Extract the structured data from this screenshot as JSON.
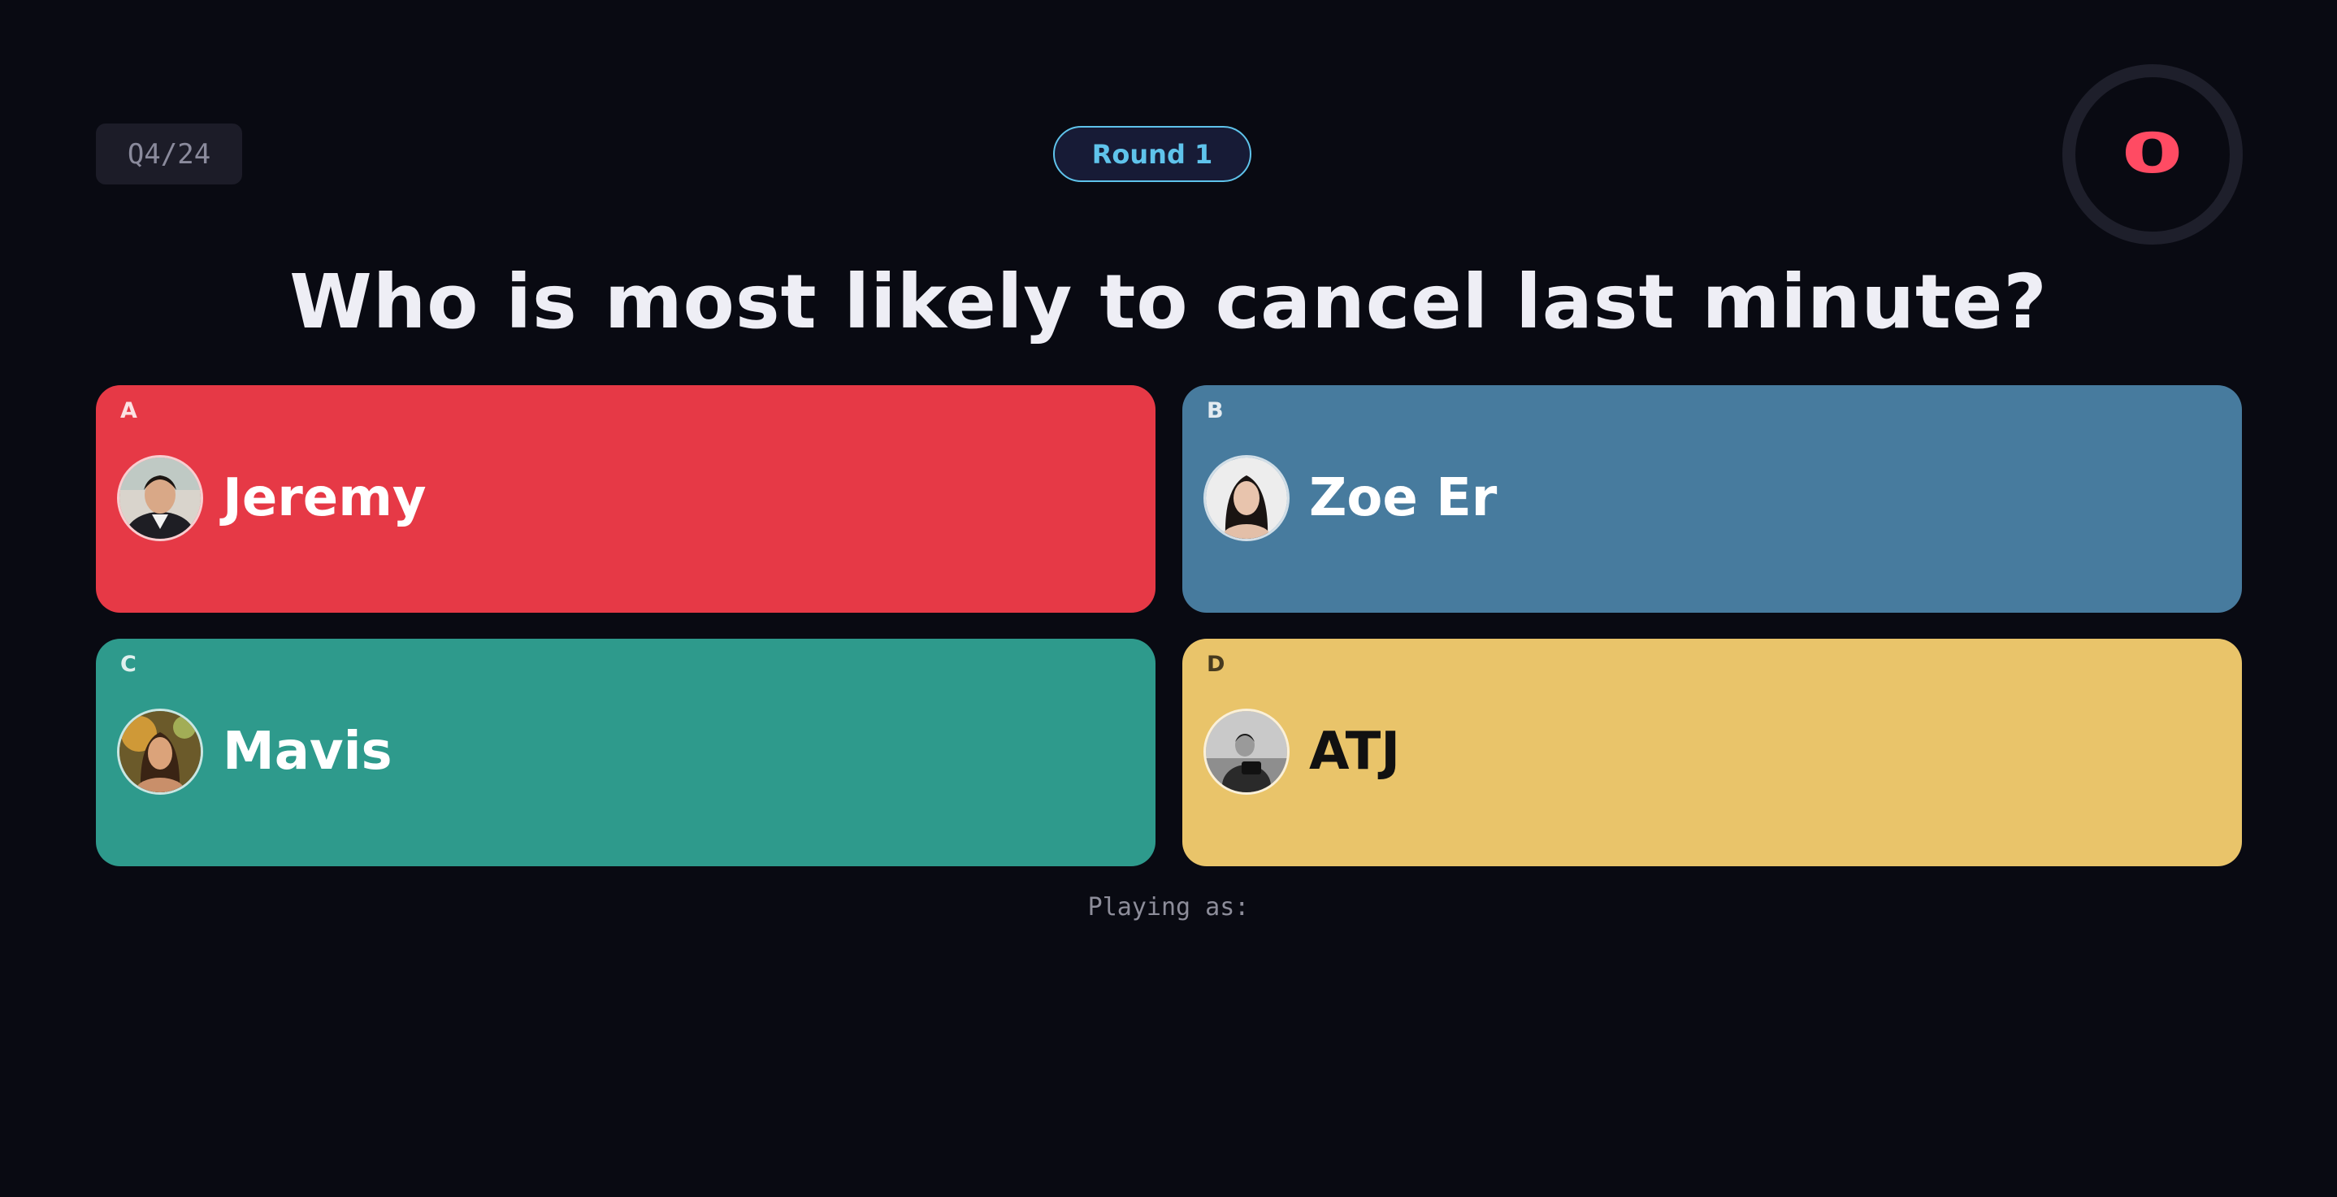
{
  "header": {
    "counter": "Q4/24",
    "round": "Round 1",
    "timer": "0"
  },
  "question": "Who is most likely to cancel last minute?",
  "options": [
    {
      "letter": "A",
      "name": "Jeremy",
      "color": "#e63946"
    },
    {
      "letter": "B",
      "name": "Zoe Er",
      "color": "#477b9e"
    },
    {
      "letter": "C",
      "name": "Mavis",
      "color": "#2e9a8c"
    },
    {
      "letter": "D",
      "name": "ATJ",
      "color": "#e9c46a"
    }
  ],
  "footer": {
    "playing_as": "Playing as:"
  }
}
